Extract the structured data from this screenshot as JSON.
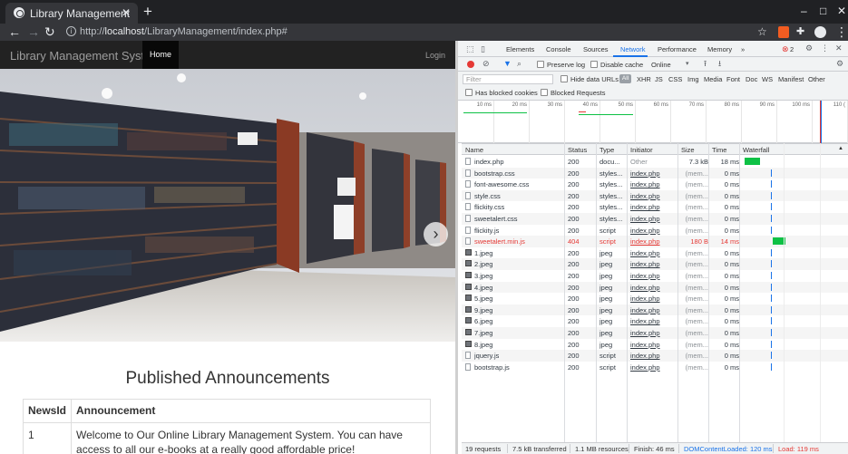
{
  "browser": {
    "tab_title": "Library Management",
    "close_glyph": "✕",
    "newtab_glyph": "+",
    "url_host": "localhost",
    "url_prefix": "http://",
    "url_path": "/LibraryManagement/index.php#",
    "window": {
      "minimize": "–",
      "maximize": "□",
      "close": "✕"
    }
  },
  "site": {
    "brand": "Library Management System",
    "nav_home": "Home",
    "nav_login": "Login",
    "carousel_next": "›",
    "announcements_title": "Published Announcements",
    "table": {
      "headers": [
        "NewsId",
        "Announcement"
      ],
      "rows": [
        {
          "id": "1",
          "text": "Welcome to Our Online Library Management System. You can have access to all our e-books at a really good affordable price!"
        }
      ]
    }
  },
  "devtools": {
    "tabs": [
      "Elements",
      "Console",
      "Sources",
      "Network",
      "Performance",
      "Memory"
    ],
    "more": "»",
    "error_count": "2",
    "toolbar": {
      "preserve_log": "Preserve log",
      "disable_cache": "Disable cache",
      "throttle": "Online"
    },
    "filter": {
      "placeholder": "Filter",
      "hide_data_urls": "Hide data URLs",
      "all": "All",
      "types": [
        "XHR",
        "JS",
        "CSS",
        "Img",
        "Media",
        "Font",
        "Doc",
        "WS",
        "Manifest",
        "Other"
      ],
      "has_blocked_cookies": "Has blocked cookies",
      "blocked_requests": "Blocked Requests"
    },
    "timeline_ticks": [
      "10 ms",
      "20 ms",
      "30 ms",
      "40 ms",
      "50 ms",
      "60 ms",
      "70 ms",
      "80 ms",
      "90 ms",
      "100 ms",
      "110 ("
    ],
    "columns": [
      "Name",
      "Status",
      "Type",
      "Initiator",
      "Size",
      "Time",
      "Waterfall"
    ],
    "requests": [
      {
        "name": "index.php",
        "status": "200",
        "type": "docu...",
        "initiator": "Other",
        "size": "7.3 kB",
        "time": "18 ms",
        "kind": "doc"
      },
      {
        "name": "bootstrap.css",
        "status": "200",
        "type": "styles...",
        "initiator": "index.php",
        "size": "(mem...",
        "time": "0 ms",
        "kind": "doc"
      },
      {
        "name": "font-awesome.css",
        "status": "200",
        "type": "styles...",
        "initiator": "index.php",
        "size": "(mem...",
        "time": "0 ms",
        "kind": "doc"
      },
      {
        "name": "style.css",
        "status": "200",
        "type": "styles...",
        "initiator": "index.php",
        "size": "(mem...",
        "time": "0 ms",
        "kind": "doc"
      },
      {
        "name": "flickity.css",
        "status": "200",
        "type": "styles...",
        "initiator": "index.php",
        "size": "(mem...",
        "time": "0 ms",
        "kind": "doc"
      },
      {
        "name": "sweetalert.css",
        "status": "200",
        "type": "styles...",
        "initiator": "index.php",
        "size": "(mem...",
        "time": "0 ms",
        "kind": "doc"
      },
      {
        "name": "flickity.js",
        "status": "200",
        "type": "script",
        "initiator": "index.php",
        "size": "(mem...",
        "time": "0 ms",
        "kind": "doc"
      },
      {
        "name": "sweetalert.min.js",
        "status": "404",
        "type": "script",
        "initiator": "index.php",
        "size": "180 B",
        "time": "14 ms",
        "kind": "doc"
      },
      {
        "name": "1.jpeg",
        "status": "200",
        "type": "jpeg",
        "initiator": "index.php",
        "size": "(mem...",
        "time": "0 ms",
        "kind": "img"
      },
      {
        "name": "2.jpeg",
        "status": "200",
        "type": "jpeg",
        "initiator": "index.php",
        "size": "(mem...",
        "time": "0 ms",
        "kind": "img"
      },
      {
        "name": "3.jpeg",
        "status": "200",
        "type": "jpeg",
        "initiator": "index.php",
        "size": "(mem...",
        "time": "0 ms",
        "kind": "img"
      },
      {
        "name": "4.jpeg",
        "status": "200",
        "type": "jpeg",
        "initiator": "index.php",
        "size": "(mem...",
        "time": "0 ms",
        "kind": "img"
      },
      {
        "name": "5.jpeg",
        "status": "200",
        "type": "jpeg",
        "initiator": "index.php",
        "size": "(mem...",
        "time": "0 ms",
        "kind": "img"
      },
      {
        "name": "9.jpeg",
        "status": "200",
        "type": "jpeg",
        "initiator": "index.php",
        "size": "(mem...",
        "time": "0 ms",
        "kind": "img"
      },
      {
        "name": "6.jpeg",
        "status": "200",
        "type": "jpeg",
        "initiator": "index.php",
        "size": "(mem...",
        "time": "0 ms",
        "kind": "img"
      },
      {
        "name": "7.jpeg",
        "status": "200",
        "type": "jpeg",
        "initiator": "index.php",
        "size": "(mem...",
        "time": "0 ms",
        "kind": "img"
      },
      {
        "name": "8.jpeg",
        "status": "200",
        "type": "jpeg",
        "initiator": "index.php",
        "size": "(mem...",
        "time": "0 ms",
        "kind": "img"
      },
      {
        "name": "jquery.js",
        "status": "200",
        "type": "script",
        "initiator": "index.php",
        "size": "(mem...",
        "time": "0 ms",
        "kind": "doc"
      },
      {
        "name": "bootstrap.js",
        "status": "200",
        "type": "script",
        "initiator": "index.php",
        "size": "(mem...",
        "time": "0 ms",
        "kind": "doc"
      }
    ],
    "summary": {
      "requests": "19 requests",
      "transferred": "7.5 kB transferred",
      "resources": "1.1 MB resources",
      "finish": "Finish: 46 ms",
      "dcl": "DOMContentLoaded: 120 ms",
      "load": "Load: 119 ms"
    },
    "colors": {
      "accent": "#1a73e8",
      "error": "#e53935",
      "bar": "#0ec145"
    }
  }
}
